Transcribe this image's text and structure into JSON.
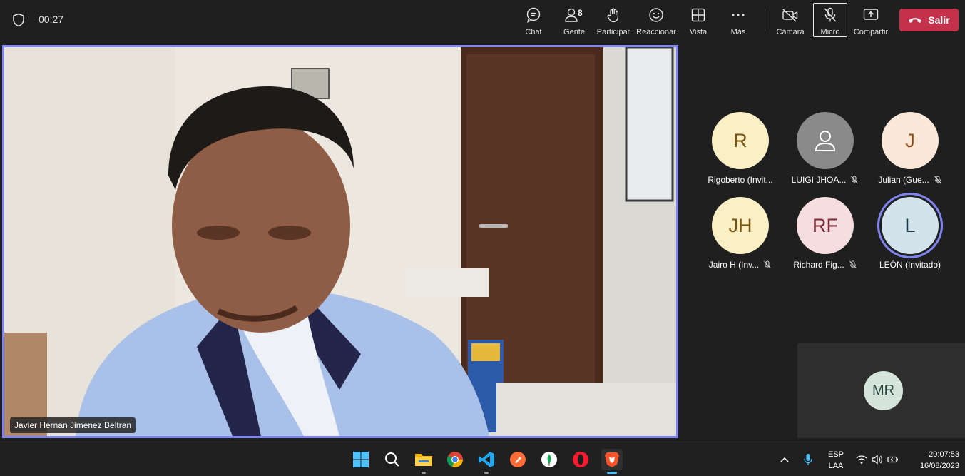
{
  "meeting": {
    "timer": "00:27"
  },
  "toolbar": {
    "chat_label": "Chat",
    "people_label": "Gente",
    "people_count": "8",
    "raise_label": "Participar",
    "react_label": "Reaccionar",
    "view_label": "Vista",
    "more_label": "Más",
    "camera_label": "Cámara",
    "mic_label": "Micro",
    "share_label": "Compartir",
    "leave_label": "Salir"
  },
  "main_video": {
    "speaker_name": "Javier Hernan Jimenez Beltran"
  },
  "participants": [
    {
      "initials": "R",
      "name": "Rigoberto (Invit...",
      "muted": false,
      "avatar_bg": "#fbefc6",
      "avatar_fg": "#7a5511"
    },
    {
      "initials": "",
      "name": "LUIGI JHOA...",
      "muted": true,
      "avatar_bg": "#8a8a8a",
      "avatar_fg": "#ffffff"
    },
    {
      "initials": "J",
      "name": "Julian (Gue...",
      "muted": true,
      "avatar_bg": "#fbe8d8",
      "avatar_fg": "#8a4a1a"
    },
    {
      "initials": "JH",
      "name": "Jairo H (Inv...",
      "muted": true,
      "avatar_bg": "#fbefc6",
      "avatar_fg": "#7a5511"
    },
    {
      "initials": "RF",
      "name": "Richard Fig...",
      "muted": true,
      "avatar_bg": "#f6dde0",
      "avatar_fg": "#7a2b35"
    },
    {
      "initials": "L",
      "name": "LEÓN (Invitado)",
      "muted": false,
      "avatar_bg": "#d3e3ec",
      "avatar_fg": "#1d3a4a"
    }
  ],
  "self_view": {
    "initials": "MR"
  },
  "taskbar": {
    "lang_line1": "ESP",
    "lang_line2": "LAA",
    "time": "20:07:53",
    "date": "16/08/2023"
  },
  "colors": {
    "accent": "#7f85f5",
    "leave": "#c4314b",
    "background": "#1f1f1f"
  }
}
